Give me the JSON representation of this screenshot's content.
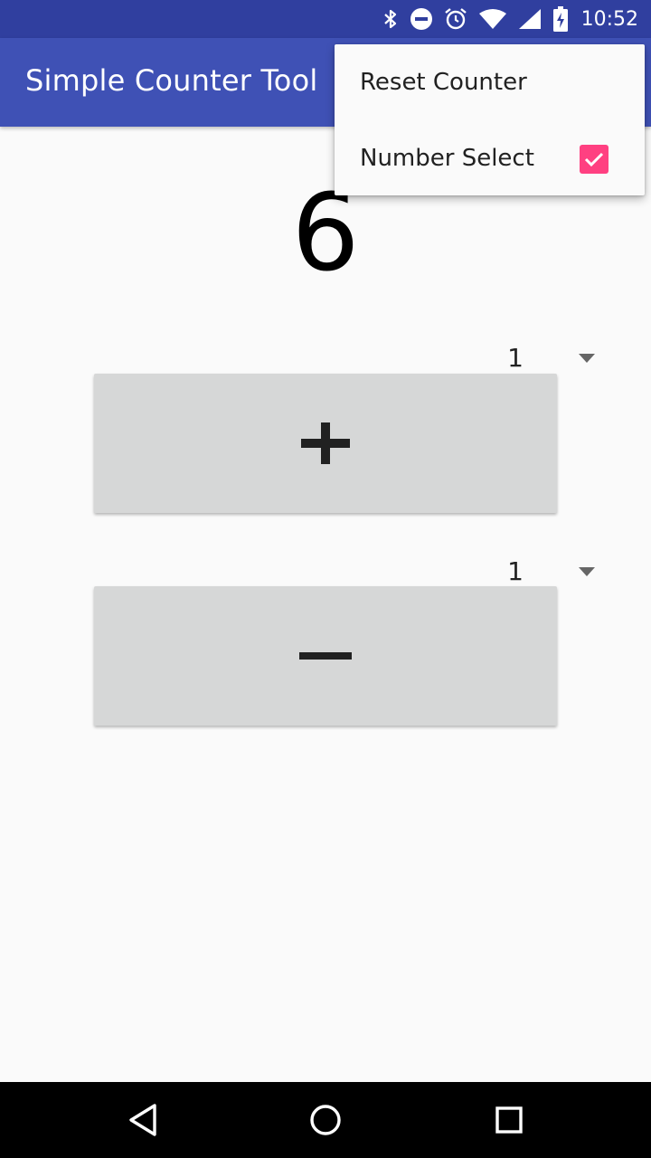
{
  "status_bar": {
    "time": "10:52",
    "icons": [
      "bluetooth-icon",
      "do-not-disturb-icon",
      "alarm-icon",
      "wifi-icon",
      "cell-signal-icon",
      "battery-charging-icon"
    ]
  },
  "app_bar": {
    "title": "Simple Counter Tool",
    "color": "#3f51b5"
  },
  "counter": {
    "value": "6"
  },
  "increment": {
    "step_value": "1",
    "button_symbol": "+",
    "button_icon": "plus-icon"
  },
  "decrement": {
    "step_value": "1",
    "button_symbol": "−",
    "button_icon": "minus-icon"
  },
  "overflow_menu": {
    "items": [
      {
        "label": "Reset Counter"
      },
      {
        "label": "Number Select",
        "checked": true
      }
    ],
    "checkbox_color": "#ff4081"
  },
  "nav_bar": {
    "buttons": [
      "back-icon",
      "home-icon",
      "recents-icon"
    ]
  }
}
